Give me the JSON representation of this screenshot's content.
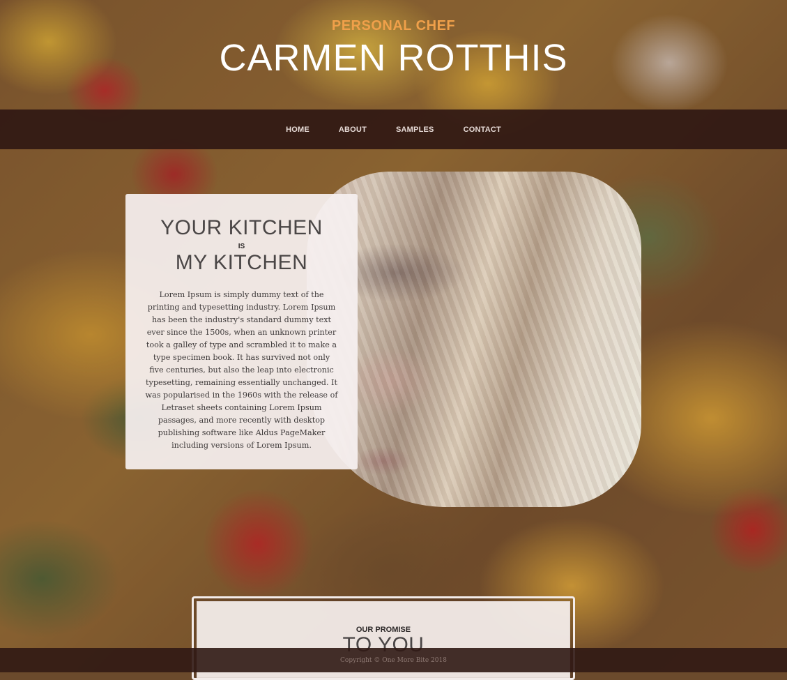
{
  "header": {
    "subtitle": "PERSONAL CHEF",
    "title": "CARMEN ROTTHIS"
  },
  "nav": {
    "items": [
      "HOME",
      "ABOUT",
      "SAMPLES",
      "CONTACT"
    ]
  },
  "intro": {
    "heading_line1": "YOUR KITCHEN",
    "heading_connector": "IS",
    "heading_line2": "MY KITCHEN",
    "body": "Lorem Ipsum is simply dummy text of the printing and typesetting industry. Lorem Ipsum has been the industry's standard dummy text ever since the 1500s, when an unknown printer took a galley of type and scrambled it to make a type specimen book. It has survived not only five centuries, but also the leap into electronic typesetting, remaining essentially unchanged. It was popularised in the 1960s with the release of Letraset sheets containing Lorem Ipsum passages, and more recently with desktop publishing software like Aldus PageMaker including versions of Lorem Ipsum."
  },
  "promise": {
    "label": "OUR PROMISE",
    "title": "TO YOU"
  },
  "footer": {
    "copyright": "Copyright © One More Bite 2018"
  },
  "colors": {
    "accent": "#f0a04a",
    "nav_bg": "#301814",
    "card_bg": "#f6f0f0"
  }
}
